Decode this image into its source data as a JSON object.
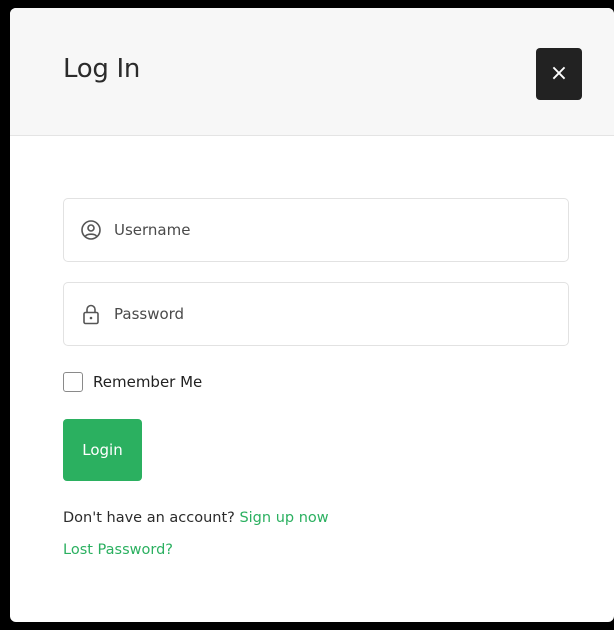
{
  "modal": {
    "title": "Log In",
    "close_label": "×"
  },
  "form": {
    "username": {
      "placeholder": "Username",
      "value": "",
      "icon": "user-circle-icon"
    },
    "password": {
      "placeholder": "Password",
      "value": "",
      "icon": "lock-icon"
    },
    "remember_label": "Remember Me",
    "remember_checked": false,
    "login_label": "Login"
  },
  "footer": {
    "signup_prompt": "Don't have an account?",
    "signup_link": "Sign up now",
    "lost_password_link": "Lost Password?"
  },
  "colors": {
    "accent": "#2bb060",
    "close_bg": "#222222",
    "header_bg": "#f7f7f7"
  }
}
